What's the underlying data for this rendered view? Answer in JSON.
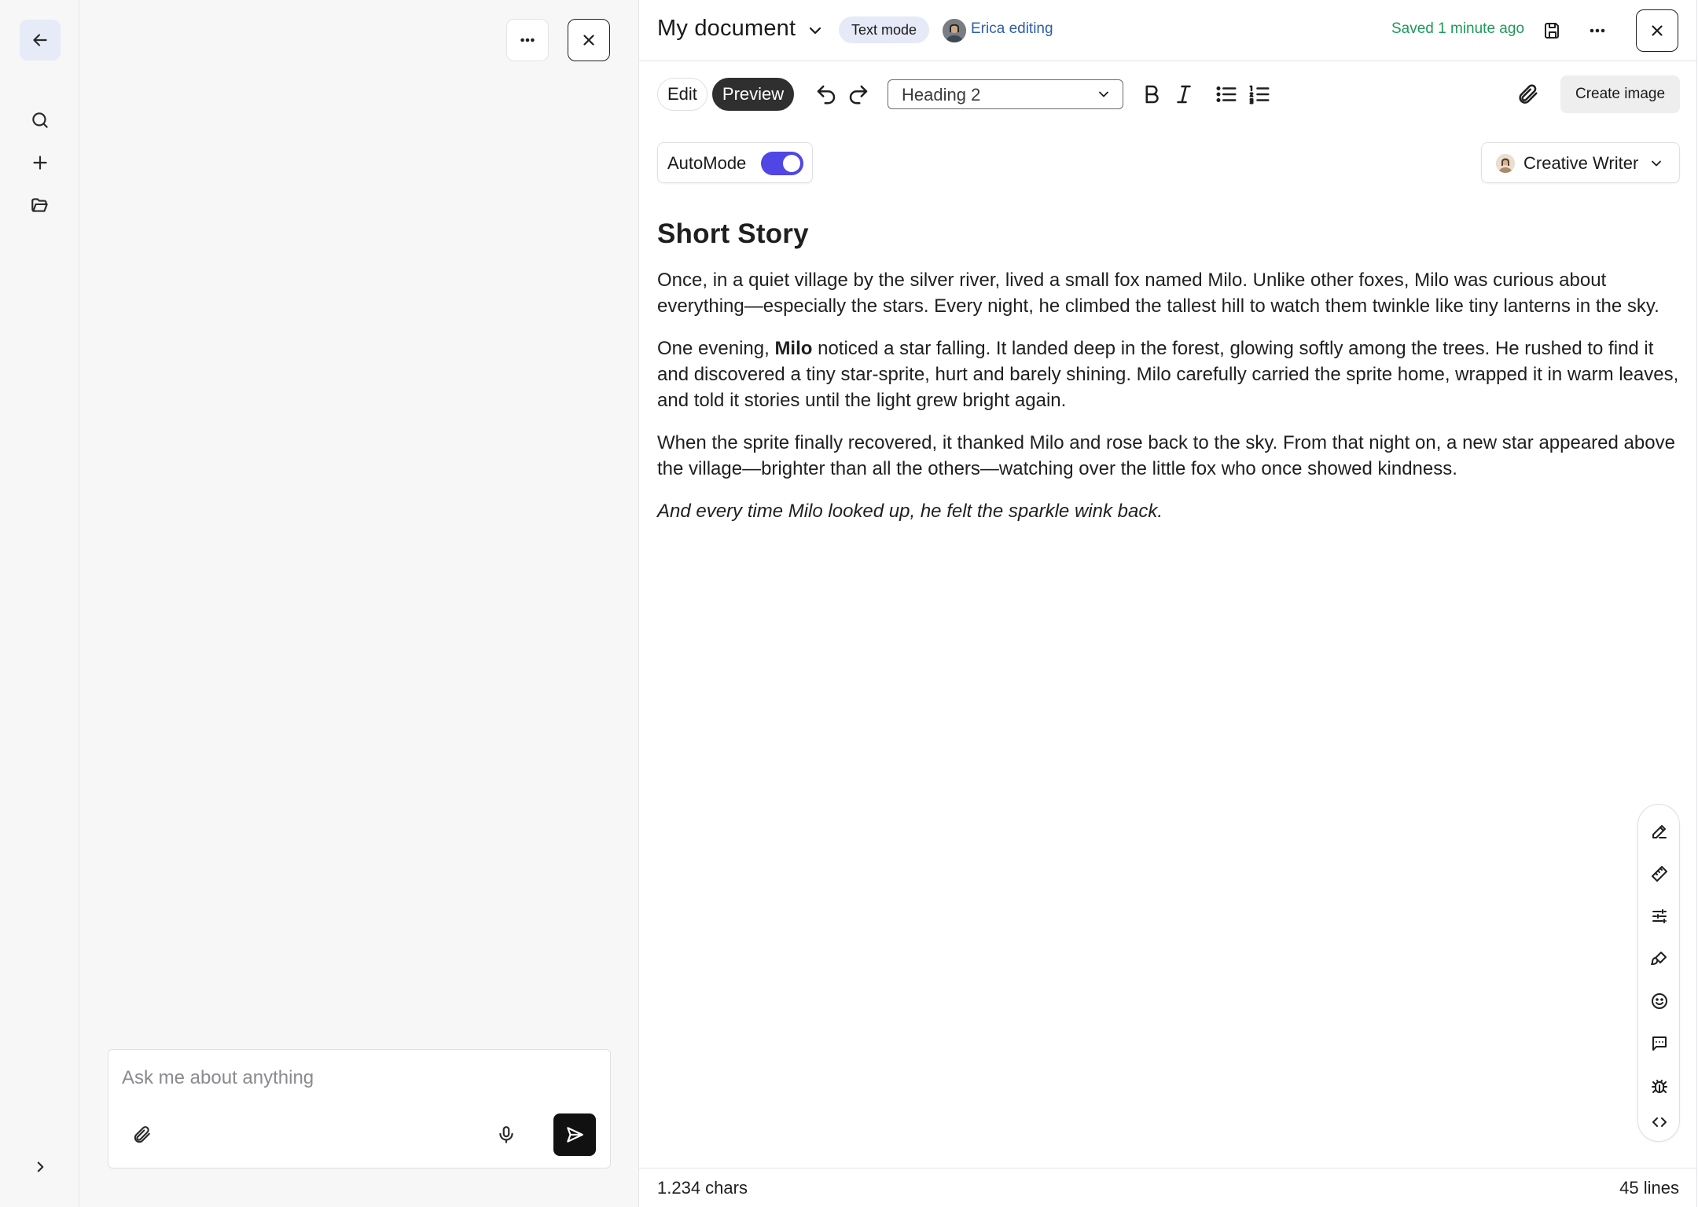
{
  "chat": {
    "composer_placeholder": "Ask me about anything"
  },
  "document": {
    "title": "My document",
    "mode_badge": "Text mode",
    "editor_status": "Erica editing",
    "saved_status": "Saved 1 minute ago",
    "view_tabs": [
      {
        "label": "Edit",
        "active": false
      },
      {
        "label": "Preview",
        "active": true
      }
    ],
    "block_style": "Heading 2",
    "create_image_label": "Create image",
    "automode_label": "AutoMode",
    "automode_on": true,
    "persona_label": "Creative Writer",
    "heading": "Short Story",
    "paragraphs": [
      "Once, in a quiet village by the silver river, lived a small fox named Milo. Unlike other foxes, Milo was curious about everything—especially the stars. Every night, he climbed the tallest hill to watch them twinkle like tiny lanterns in the sky.",
      {
        "before": "One evening, ",
        "bold": "Milo",
        "after": " noticed a star falling. It landed deep in the forest, glowing softly among the trees. He rushed to find it and discovered a tiny star-sprite, hurt and barely shining. Milo carefully carried the sprite home, wrapped it in warm leaves, and told it stories until the light grew bright again."
      },
      "When the sprite finally recovered, it thanked Milo and rose back to the sky. From that night on, a new star appeared above the village—brighter than all the others—watching over the little fox who once showed kindness."
    ],
    "closing_line": "And every time Milo looked up, he felt the sparkle wink back.",
    "footer_chars": "1.234 chars",
    "footer_lines": "45 lines"
  },
  "colors": {
    "accent_toggle": "#4f46e5",
    "saved_green": "#1e9a5a",
    "editor_blue": "#2d5fa6"
  },
  "icons": {
    "rail": [
      "arrow-left-icon",
      "search-icon",
      "plus-icon",
      "folder-open-icon",
      "chevron-right-icon"
    ],
    "side_tools": [
      "pencil-icon",
      "ruler-icon",
      "sliders-icon",
      "paintbrush-icon",
      "smiley-icon",
      "comment-icon",
      "bug-icon",
      "code-icon"
    ]
  }
}
